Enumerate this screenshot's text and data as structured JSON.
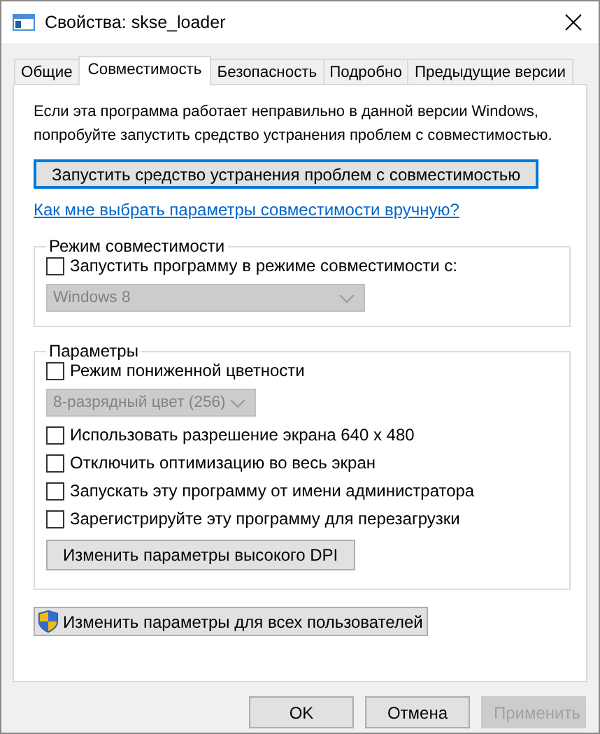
{
  "window": {
    "title": "Свойства: skse_loader"
  },
  "tabs": [
    {
      "label": "Общие",
      "selected": false
    },
    {
      "label": "Совместимость",
      "selected": true
    },
    {
      "label": "Безопасность",
      "selected": false
    },
    {
      "label": "Подробно",
      "selected": false
    },
    {
      "label": "Предыдущие версии",
      "selected": false
    }
  ],
  "intro": "Если эта программа работает неправильно в данной версии Windows, попробуйте запустить средство устранения проблем с совместимостью.",
  "troubleshoot_button": {
    "label": "Запустить средство устранения проблем с совместимостью",
    "focused": true
  },
  "help_link": "Как мне выбрать параметры совместимости вручную?",
  "compat_group": {
    "title": "Режим совместимости",
    "items": [
      {
        "kind": "checkbox",
        "label": "Запустить программу в режиме совместимости с:",
        "checked": false
      },
      {
        "kind": "dropdown",
        "value": "Windows 8",
        "disabled": true
      }
    ]
  },
  "settings_group": {
    "title": "Параметры",
    "items": [
      {
        "kind": "checkbox",
        "label": "Режим пониженной цветности",
        "checked": false
      },
      {
        "kind": "dropdown",
        "value": "8-разрядный цвет (256)",
        "disabled": true
      },
      {
        "kind": "checkbox",
        "label": "Использовать разрешение экрана 640 x 480",
        "checked": false
      },
      {
        "kind": "checkbox",
        "label": "Отключить оптимизацию во весь экран",
        "checked": false
      },
      {
        "kind": "checkbox",
        "label": "Запускать эту программу от имени администратора",
        "checked": false
      },
      {
        "kind": "checkbox",
        "label": "Зарегистрируйте эту программу для перезагрузки",
        "checked": false
      },
      {
        "kind": "button",
        "label": "Изменить параметры высокого DPI"
      }
    ]
  },
  "all_users_button": {
    "label": "Изменить параметры для всех пользователей"
  },
  "buttons": [
    {
      "label": "OK",
      "disabled": false
    },
    {
      "label": "Отмена",
      "disabled": false
    },
    {
      "label": "Применить",
      "disabled": true
    }
  ]
}
